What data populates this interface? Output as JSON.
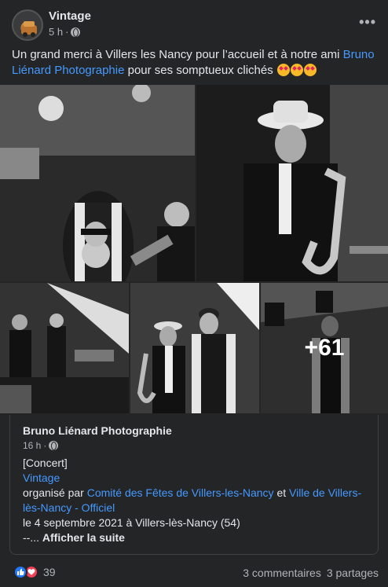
{
  "header": {
    "page_name": "Vintage",
    "time": "5 h",
    "separator": "·",
    "more_label": "•••"
  },
  "post": {
    "text_before": "Un grand merci à Villers les Nancy pour l’accueil et à notre ami ",
    "link": "Bruno Liénard Photographie",
    "text_after": " pour ses somptueux clichés ",
    "emoji_icon": "star-struck-emoji"
  },
  "photos": {
    "more_count": "+61"
  },
  "shared": {
    "name": "Bruno Liénard Photographie",
    "time": "16 h",
    "separator": "·",
    "line1": "[Concert]",
    "line2_link": "Vintage",
    "line3_prefix": "organisé par ",
    "line3_link1": "Comité des Fêtes de Villers-les-Nancy",
    "line3_mid": " et ",
    "line3_link2": "Ville de Villers-lès-Nancy - Officiel",
    "line4": "le 4 septembre 2021 à Villers-lès-Nancy (54)",
    "line5_prefix": "--... ",
    "line5_more": "Afficher la suite"
  },
  "footer": {
    "reaction_count": "39",
    "comments": "3 commentaires",
    "shares": "3 partages",
    "reaction_icons": [
      "like-icon",
      "love-icon"
    ]
  },
  "colors": {
    "background": "#242526",
    "link": "#4599ff",
    "secondary_text": "#b0b3b8",
    "like": "#2078f4",
    "love": "#f33e58"
  }
}
